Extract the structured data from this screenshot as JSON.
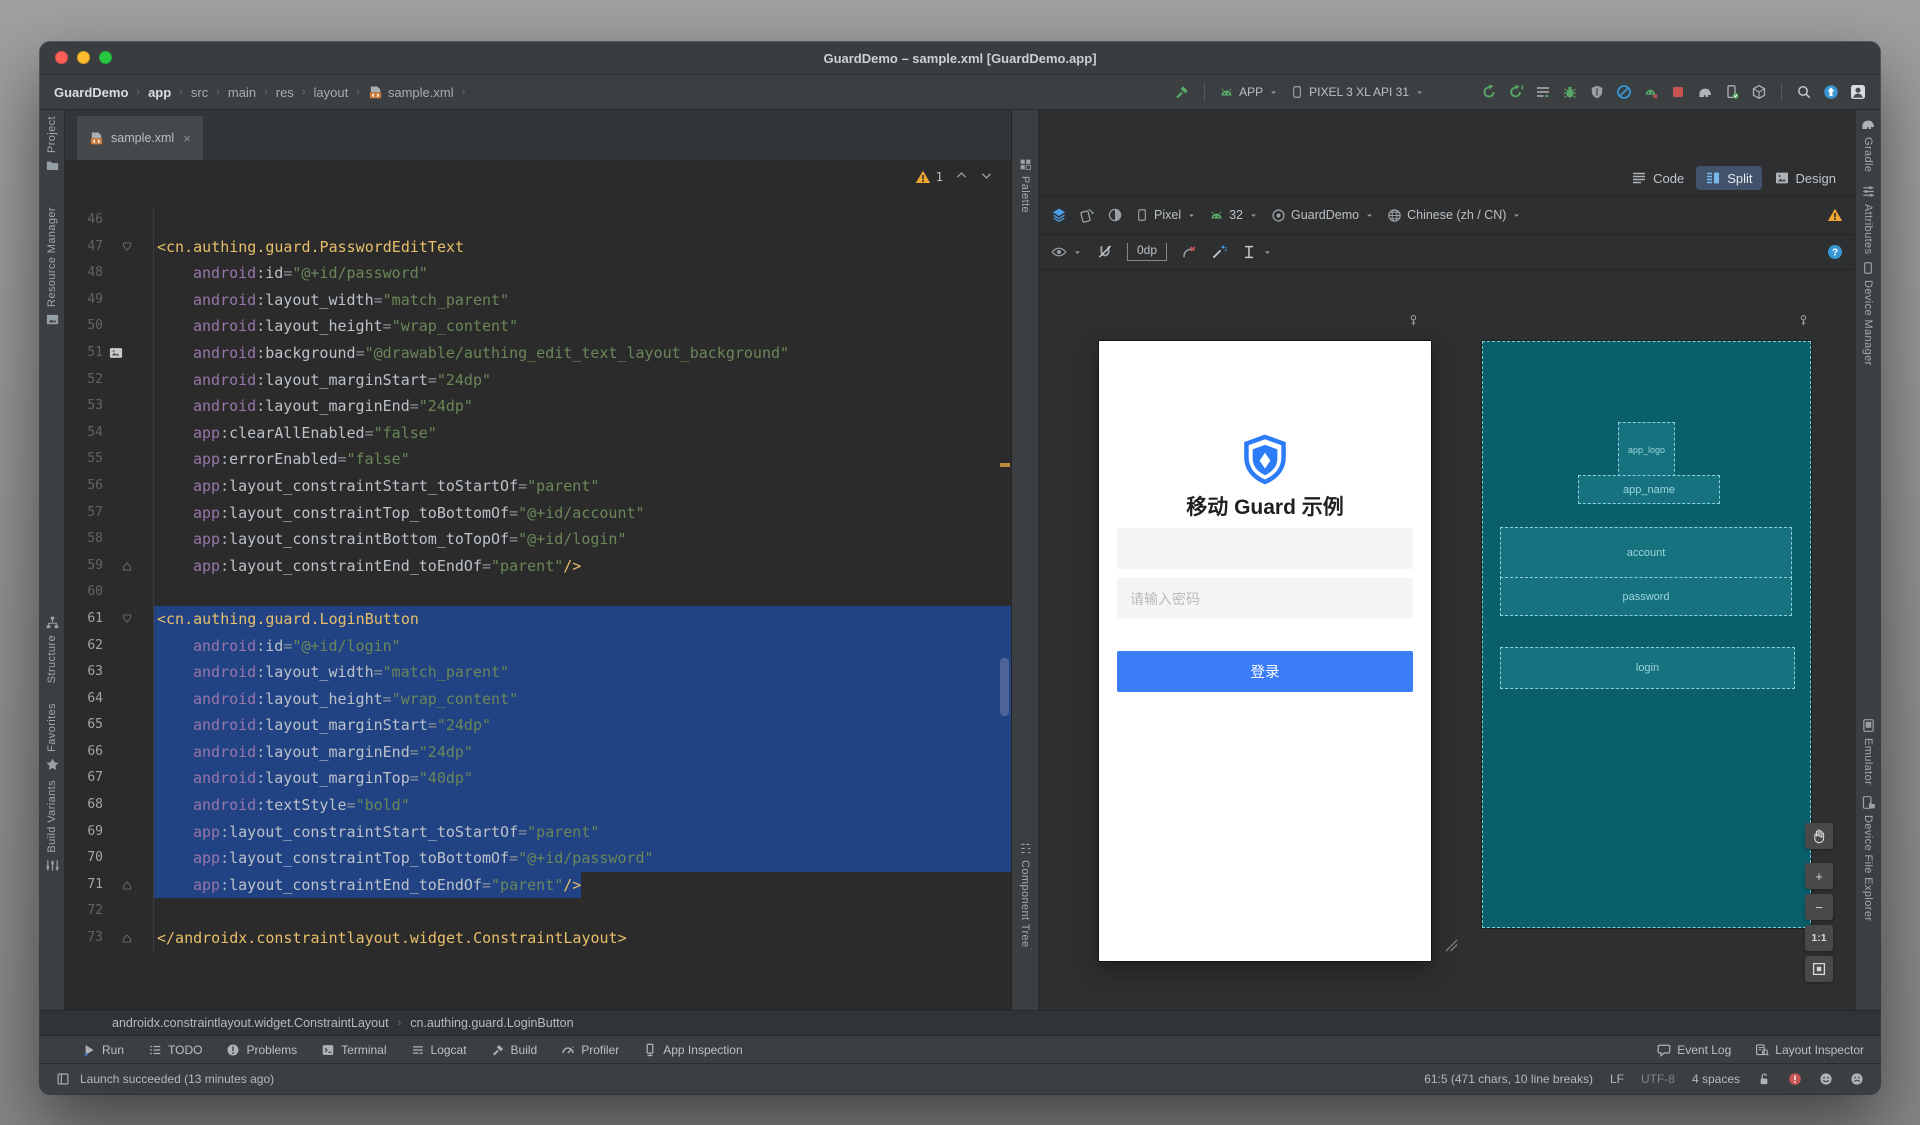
{
  "window": {
    "title": "GuardDemo – sample.xml [GuardDemo.app]"
  },
  "colors": {
    "selection": "#214283",
    "xml_tag": "#E8BF6A",
    "xml_attr_ns": "#9876AA",
    "xml_string": "#6A8759",
    "accent_blue": "#3B7CF7",
    "blueprint_bg": "#0A5F6C",
    "warning_orange": "#F0A732",
    "error_red": "#C75450",
    "run_green": "#59A869"
  },
  "nav": {
    "breadcrumbs": [
      {
        "label": "GuardDemo",
        "bold": true
      },
      {
        "label": "app",
        "bold": true
      },
      {
        "label": "src"
      },
      {
        "label": "main"
      },
      {
        "label": "res"
      },
      {
        "label": "layout"
      },
      {
        "label": "sample.xml",
        "icon": "xmlfile"
      }
    ],
    "toolbar": [
      {
        "t": "btn",
        "n": "build-hammer",
        "icon": "hammer"
      },
      {
        "t": "sep"
      },
      {
        "t": "sel",
        "n": "run-config",
        "icon": "android-head",
        "label": "APP"
      },
      {
        "t": "sel",
        "n": "device",
        "icon": "phone",
        "label": "PIXEL 3 XL API 31"
      },
      {
        "t": "gap"
      },
      {
        "t": "btn",
        "n": "run-apply-changes",
        "icon": "rerun"
      },
      {
        "t": "btn",
        "n": "apply-code-changes",
        "icon": "rerun-prime"
      },
      {
        "t": "btn",
        "n": "run-menu",
        "icon": "menu-lines"
      },
      {
        "t": "btn",
        "n": "debug",
        "icon": "bug"
      },
      {
        "t": "btn",
        "n": "attach-debugger",
        "icon": "attach"
      },
      {
        "t": "btn",
        "n": "profile",
        "icon": "profiler"
      },
      {
        "t": "btn",
        "n": "attach-profiler",
        "icon": "android-x"
      },
      {
        "t": "btn",
        "n": "stop",
        "icon": "stop"
      },
      {
        "t": "btn",
        "n": "sync-gradle",
        "icon": "elephant"
      },
      {
        "t": "btn",
        "n": "device-manager",
        "icon": "device-phone"
      },
      {
        "t": "btn",
        "n": "avd-manager",
        "icon": "cube"
      },
      {
        "t": "sep"
      },
      {
        "t": "btn",
        "n": "search-everywhere",
        "icon": "search"
      },
      {
        "t": "btn",
        "n": "updates",
        "icon": "update"
      },
      {
        "t": "btn",
        "n": "profile-avatar",
        "icon": "avatar"
      }
    ]
  },
  "tabs": [
    {
      "label": "sample.xml",
      "icon": "xmlfile",
      "close_glyph": "×",
      "active": true
    }
  ],
  "left_strip": [
    {
      "label": "Project",
      "icon": "folder",
      "icon_pos": "after"
    },
    {
      "label": "Resource Manager",
      "icon": "resource",
      "icon_pos": "after"
    },
    {
      "label": "Structure",
      "icon": "structure",
      "icon_pos": "before"
    },
    {
      "label": "Favorites",
      "icon": "star",
      "icon_pos": "after"
    },
    {
      "label": "Build Variants",
      "icon": "variants",
      "icon_pos": "after"
    }
  ],
  "right_strip": [
    {
      "label": "Gradle",
      "icon": "elephant",
      "icon_pos": "before"
    },
    {
      "label": "Attributes",
      "icon": "sliders",
      "icon_pos": "before"
    },
    {
      "label": "Device Manager",
      "icon": "phone",
      "icon_pos": "before"
    },
    {
      "label": "Emulator",
      "icon": "emulator",
      "icon_pos": "before"
    },
    {
      "label": "Device File Explorer",
      "icon": "explorer",
      "icon_pos": "before"
    }
  ],
  "palette_strip": [
    {
      "label": "Palette",
      "icon": "palette"
    },
    {
      "label": "Component Tree",
      "icon": "comptree"
    }
  ],
  "editor": {
    "view_tabs": [
      {
        "label": "Code",
        "icon": "code-view"
      },
      {
        "label": "Split",
        "icon": "split-view",
        "active": true
      },
      {
        "label": "Design",
        "icon": "design-view"
      }
    ],
    "warning_count": "1",
    "lines": [
      {
        "n": "46",
        "blank": true
      },
      {
        "n": "47",
        "tag": "<cn.authing.guard.PasswordEditText",
        "gut": "open"
      },
      {
        "n": "48",
        "ns": "android",
        "name": "id",
        "val": "@+id/password"
      },
      {
        "n": "49",
        "ns": "android",
        "name": "layout_width",
        "val": "match_parent"
      },
      {
        "n": "50",
        "ns": "android",
        "name": "layout_height",
        "val": "wrap_content"
      },
      {
        "n": "51",
        "ns": "android",
        "name": "background",
        "val": "@drawable/authing_edit_text_layout_background",
        "gut": "img"
      },
      {
        "n": "52",
        "ns": "android",
        "name": "layout_marginStart",
        "val": "24dp"
      },
      {
        "n": "53",
        "ns": "android",
        "name": "layout_marginEnd",
        "val": "24dp"
      },
      {
        "n": "54",
        "ns": "app",
        "name": "clearAllEnabled",
        "val": "false"
      },
      {
        "n": "55",
        "ns": "app",
        "name": "errorEnabled",
        "val": "false"
      },
      {
        "n": "56",
        "ns": "app",
        "name": "layout_constraintStart_toStartOf",
        "val": "parent"
      },
      {
        "n": "57",
        "ns": "app",
        "name": "layout_constraintTop_toBottomOf",
        "val": "@+id/account"
      },
      {
        "n": "58",
        "ns": "app",
        "name": "layout_constraintBottom_toTopOf",
        "val": "@+id/login"
      },
      {
        "n": "59",
        "ns": "app",
        "name": "layout_constraintEnd_toEndOf",
        "val": "parent",
        "end": "/>",
        "gut": "close"
      },
      {
        "n": "60",
        "blank": true
      },
      {
        "n": "61",
        "tag": "<cn.authing.guard.LoginButton",
        "gut": "open",
        "sel": "full"
      },
      {
        "n": "62",
        "ns": "android",
        "name": "id",
        "val": "@+id/login",
        "sel": "full"
      },
      {
        "n": "63",
        "ns": "android",
        "name": "layout_width",
        "val": "match_parent",
        "sel": "full"
      },
      {
        "n": "64",
        "ns": "android",
        "name": "layout_height",
        "val": "wrap_content",
        "sel": "full"
      },
      {
        "n": "65",
        "ns": "android",
        "name": "layout_marginStart",
        "val": "24dp",
        "sel": "full"
      },
      {
        "n": "66",
        "ns": "android",
        "name": "layout_marginEnd",
        "val": "24dp",
        "sel": "full"
      },
      {
        "n": "67",
        "ns": "android",
        "name": "layout_marginTop",
        "val": "40dp",
        "sel": "full"
      },
      {
        "n": "68",
        "ns": "android",
        "name": "textStyle",
        "val": "bold",
        "sel": "full"
      },
      {
        "n": "69",
        "ns": "app",
        "name": "layout_constraintStart_toStartOf",
        "val": "parent",
        "sel": "full"
      },
      {
        "n": "70",
        "ns": "app",
        "name": "layout_constraintTop_toBottomOf",
        "val": "@+id/password",
        "sel": "full"
      },
      {
        "n": "71",
        "ns": "app",
        "name": "layout_constraintEnd_toEndOf",
        "val": "parent",
        "end": "/>",
        "gut": "close",
        "sel": "end"
      },
      {
        "n": "72",
        "blank": true
      },
      {
        "n": "73",
        "tag": "</androidx.constraintlayout.widget.ConstraintLayout>",
        "gut": "close"
      }
    ],
    "breadcrumb": [
      "androidx.constraintlayout.widget.ConstraintLayout",
      "cn.authing.guard.LoginButton"
    ]
  },
  "design": {
    "toolbar_main": [
      {
        "t": "btn",
        "n": "design-surface",
        "icon": "layers"
      },
      {
        "t": "btn",
        "n": "orientation",
        "icon": "orientation"
      },
      {
        "t": "btn",
        "n": "night-mode",
        "icon": "theme"
      },
      {
        "t": "sel",
        "n": "device-select",
        "icon": "phone",
        "label": "Pixel"
      },
      {
        "t": "sel",
        "n": "api-select",
        "icon": "android-head",
        "label": "32"
      },
      {
        "t": "sel",
        "n": "theme-select",
        "icon": "theme-circle",
        "label": "GuardDemo"
      },
      {
        "t": "sel",
        "n": "locale-select",
        "icon": "globe",
        "label": "Chinese (zh / CN)"
      },
      {
        "t": "spacer"
      },
      {
        "t": "btn",
        "n": "render-warning",
        "icon": "warn-tri"
      }
    ],
    "toolbar_constraints": [
      {
        "t": "sel-ic",
        "n": "view-options",
        "icon": "eye"
      },
      {
        "t": "btn",
        "n": "autoconnect-off",
        "icon": "magnet-off"
      },
      {
        "t": "margin",
        "n": "default-margin",
        "label": "0dp"
      },
      {
        "t": "btn",
        "n": "clear-constraints",
        "icon": "clear-constraints"
      },
      {
        "t": "btn",
        "n": "infer-constraints",
        "icon": "infer"
      },
      {
        "t": "sel-ic",
        "n": "align",
        "icon": "ibeam"
      },
      {
        "t": "spacer"
      },
      {
        "t": "btn",
        "n": "help",
        "icon": "help"
      }
    ],
    "zoom_controls": [
      {
        "n": "pan",
        "icon": "pan-hand"
      },
      {
        "n": "zoom-in",
        "label": "+"
      },
      {
        "n": "zoom-out",
        "label": "−"
      },
      {
        "n": "zoom-ratio",
        "label": "1:1"
      },
      {
        "n": "zoom-to-fit",
        "icon": "zoom-fit"
      }
    ],
    "phone_preview": {
      "app_title": "移动 Guard 示例",
      "password_placeholder": "请输入密码",
      "login_label": "登录"
    },
    "blueprint_labels": [
      "app_logo",
      "app_name",
      "account",
      "password",
      "login"
    ]
  },
  "bottom_bar": {
    "left": [
      {
        "label": "Run",
        "icon": "run"
      },
      {
        "label": "TODO",
        "icon": "todo"
      },
      {
        "label": "Problems",
        "icon": "problems"
      },
      {
        "label": "Terminal",
        "icon": "terminal"
      },
      {
        "label": "Logcat",
        "icon": "logcat"
      },
      {
        "label": "Build",
        "icon": "build"
      },
      {
        "label": "Profiler",
        "icon": "profiler-gauge"
      },
      {
        "label": "App Inspection",
        "icon": "inspection"
      }
    ],
    "right": [
      {
        "label": "Event Log",
        "icon": "event-log"
      },
      {
        "label": "Layout Inspector",
        "icon": "layout-inspector"
      }
    ]
  },
  "status_bar": {
    "message": "Launch succeeded (13 minutes ago)",
    "caret_position": "61:5 (471 chars, 10 line breaks)",
    "line_separator": "LF",
    "encoding": "UTF-8",
    "indent": "4 spaces",
    "icons": [
      "lock",
      "error-badge",
      "smile",
      "frown"
    ]
  }
}
